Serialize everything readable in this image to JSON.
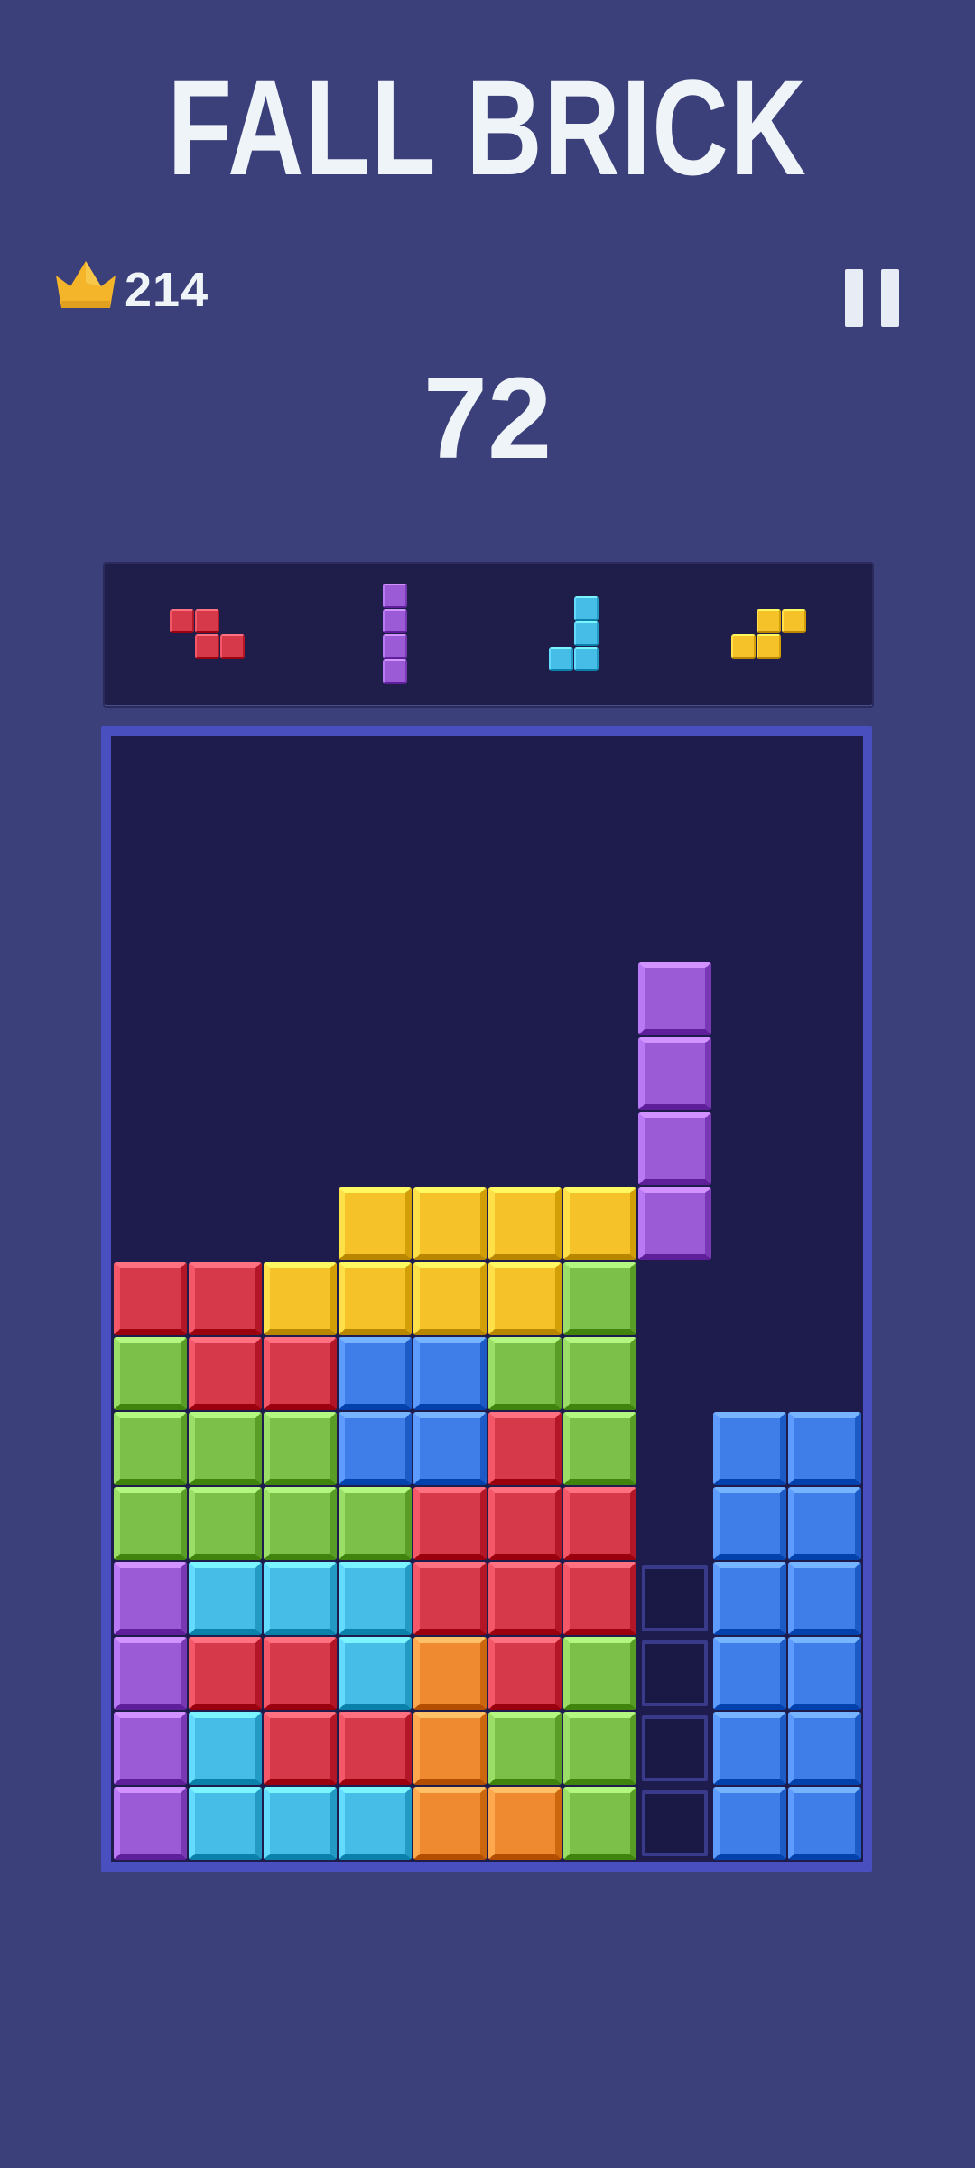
{
  "game": {
    "title": "FALL BRICK",
    "best_score": "214",
    "current_score": "72"
  },
  "icons": {
    "crown": "crown-icon",
    "pause": "pause-icon"
  },
  "colors": {
    "background": "#3b3f7a",
    "board": "#1e1c4c",
    "board_frame": "#4a4fc0",
    "red": "#d63a4a",
    "yellow": "#f5c22a",
    "green": "#7cc04a",
    "blue": "#3f7de8",
    "cyan": "#45bde6",
    "purple": "#9b5bd6",
    "orange": "#ef8a30",
    "crown": "#f4b52a"
  },
  "next_queue": [
    {
      "shape": "Z",
      "color": "red"
    },
    {
      "shape": "I",
      "color": "purple"
    },
    {
      "shape": "J",
      "color": "cyan"
    },
    {
      "shape": "S",
      "color": "yellow"
    }
  ],
  "board": {
    "columns": 10,
    "rows": 15,
    "falling_piece": {
      "shape": "I",
      "color": "purple",
      "cells": [
        [
          3,
          7
        ],
        [
          4,
          7
        ],
        [
          5,
          7
        ],
        [
          6,
          7
        ]
      ]
    },
    "grid": [
      ".........",
      ".........",
      ".........",
      ".........",
      ".........",
      ".........",
      "...YYYY...",
      "RRYYYYG...",
      "GRRBBGG...",
      "GGGBBRG.BB",
      "GGGGRRR.BB",
      "PCCCRRR.BB",
      "PRRCORG.BB",
      "PCRROGG.BB",
      "PCCCOOG.BB"
    ],
    "ghost_cells": [
      [
        11,
        7
      ],
      [
        12,
        7
      ],
      [
        13,
        7
      ],
      [
        14,
        7
      ]
    ]
  }
}
